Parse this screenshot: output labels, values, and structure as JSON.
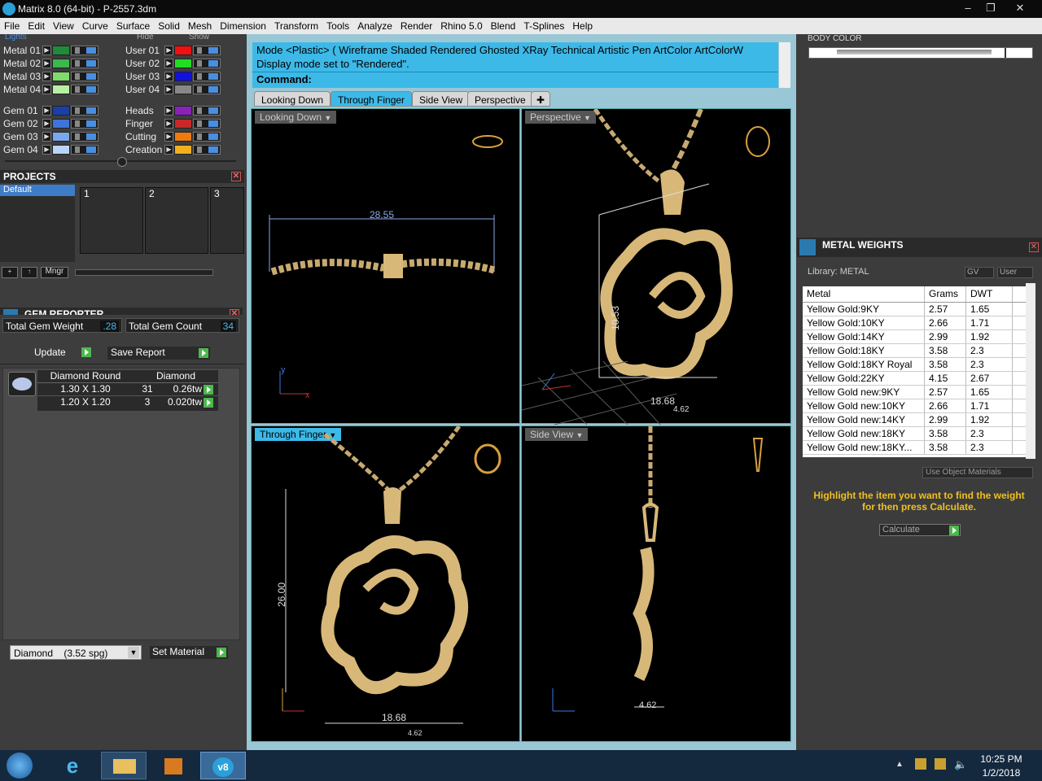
{
  "window": {
    "title": "Matrix 8.0 (64-bit) - P-2557.3dm"
  },
  "menu": [
    "File",
    "Edit",
    "View",
    "Curve",
    "Surface",
    "Solid",
    "Mesh",
    "Dimension",
    "Transform",
    "Tools",
    "Analyze",
    "Render",
    "Rhino 5.0",
    "Blend",
    "T-Splines",
    "Help"
  ],
  "layers_top": {
    "lights": "Lights",
    "hide": "Hide",
    "show": "Show"
  },
  "layers_left": [
    {
      "name": "Metal 01",
      "color": "#1f8a3a"
    },
    {
      "name": "Metal 02",
      "color": "#3cb84c"
    },
    {
      "name": "Metal 03",
      "color": "#7fdb6a"
    },
    {
      "name": "Metal 04",
      "color": "#b8f0a0"
    },
    {
      "name": "Gem 01",
      "color": "#1a3fa8"
    },
    {
      "name": "Gem 02",
      "color": "#3e74d8"
    },
    {
      "name": "Gem 03",
      "color": "#7aa8ec"
    },
    {
      "name": "Gem 04",
      "color": "#b8d4f8"
    }
  ],
  "layers_right": [
    {
      "name": "User 01",
      "color": "#ee1111"
    },
    {
      "name": "User 02",
      "color": "#22dd22"
    },
    {
      "name": "User 03",
      "color": "#1111dd"
    },
    {
      "name": "User 04",
      "color": "#888888"
    },
    {
      "name": "Heads",
      "color": "#8a22b8"
    },
    {
      "name": "Finger",
      "color": "#c82828"
    },
    {
      "name": "Cutting",
      "color": "#ee7a10"
    },
    {
      "name": "Creation",
      "color": "#f0b020"
    }
  ],
  "projects": {
    "title": "PROJECTS",
    "default": "Default",
    "slots": [
      "1",
      "2",
      "3"
    ],
    "mngr": "Mngr"
  },
  "gem_reporter": {
    "title": "GEM REPORTER",
    "total_weight_label": "Total Gem Weight",
    "total_weight": ".28",
    "total_count_label": "Total Gem Count",
    "total_count": "34",
    "update": "Update",
    "save_report": "Save Report",
    "col1": "Diamond Round",
    "col2": "Diamond",
    "rows": [
      {
        "size": "1.30 X 1.30",
        "count": "31",
        "tw": "0.26tw"
      },
      {
        "size": "1.20 X 1.20",
        "count": "3",
        "tw": "0.020tw"
      }
    ],
    "material_select": "Diamond    (3.52 spg)",
    "set_material": "Set Material"
  },
  "command": {
    "line1": "Mode <Plastic> ( Wireframe  Shaded  Rendered  Ghosted  XRay  Technical  Artistic  Pen  ArtColor  ArtColorW",
    "line2": "Display mode set to \"Rendered\".",
    "prompt": "Command:"
  },
  "view_tabs": [
    "Looking Down",
    "Through Finger",
    "Side View",
    "Perspective"
  ],
  "viewports": {
    "top_left": {
      "label": "Looking Down",
      "dim": "28.55"
    },
    "top_right": {
      "label": "Perspective",
      "dim1": "10.53",
      "dim2": "18.68",
      "dim3": "4.62"
    },
    "bottom_left": {
      "label": "Through Finger",
      "dim1": "26.00",
      "dim2": "18.68",
      "dim3": "4.62"
    },
    "bottom_right": {
      "label": "Side View",
      "dim": "4.62"
    }
  },
  "body_color": {
    "title": "BODY COLOR"
  },
  "metal_weights": {
    "title": "METAL WEIGHTS",
    "library": "Library: METAL",
    "gv": "GV",
    "user": "User",
    "headers": [
      "Metal",
      "Grams",
      "DWT"
    ],
    "rows": [
      [
        "Yellow Gold:9KY",
        "2.57",
        "1.65"
      ],
      [
        "Yellow Gold:10KY",
        "2.66",
        "1.71"
      ],
      [
        "Yellow Gold:14KY",
        "2.99",
        "1.92"
      ],
      [
        "Yellow Gold:18KY",
        "3.58",
        "2.3"
      ],
      [
        "Yellow Gold:18KY Royal",
        "3.58",
        "2.3"
      ],
      [
        "Yellow Gold:22KY",
        "4.15",
        "2.67"
      ],
      [
        "Yellow Gold new:9KY",
        "2.57",
        "1.65"
      ],
      [
        "Yellow Gold new:10KY",
        "2.66",
        "1.71"
      ],
      [
        "Yellow Gold new:14KY",
        "2.99",
        "1.92"
      ],
      [
        "Yellow Gold new:18KY",
        "3.58",
        "2.3"
      ],
      [
        "Yellow Gold new:18KY...",
        "3.58",
        "2.3"
      ]
    ],
    "use_object_materials": "Use Object Materials",
    "hint": "Highlight the item you want to find the weight for then press Calculate.",
    "calculate": "Calculate"
  },
  "taskbar": {
    "time": "10:25 PM",
    "date": "1/2/2018"
  }
}
